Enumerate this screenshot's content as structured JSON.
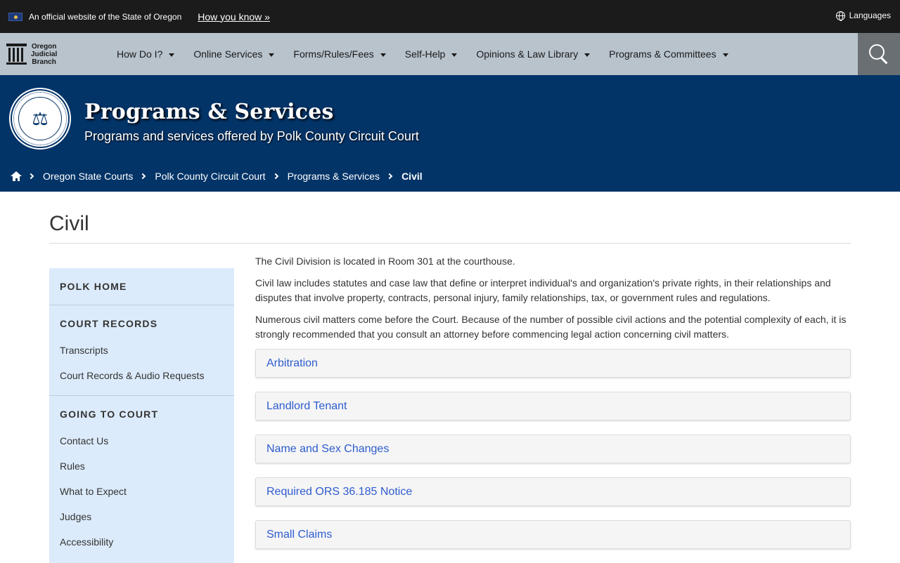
{
  "official": {
    "text": "An official website of the State of Oregon",
    "how_you_know": "How you know »",
    "languages": "Languages"
  },
  "logo": {
    "line1": "Oregon",
    "line2": "Judicial",
    "line3": "Branch"
  },
  "nav": {
    "items": [
      {
        "label": "How Do I?"
      },
      {
        "label": "Online Services"
      },
      {
        "label": "Forms/Rules/Fees"
      },
      {
        "label": "Self-Help"
      },
      {
        "label": "Opinions & Law Library"
      },
      {
        "label": "Programs & Committees"
      }
    ]
  },
  "banner": {
    "title": "Programs & Services",
    "subtitle": "Programs and services offered by Polk County Circuit Court"
  },
  "breadcrumb": {
    "items": [
      {
        "label": "Oregon State Courts"
      },
      {
        "label": "Polk County Circuit Court"
      },
      {
        "label": "Programs & Services"
      },
      {
        "label": "Civil"
      }
    ]
  },
  "page": {
    "title": "Civil",
    "paragraphs": [
      "The Civil Division is located in Room 301 at the courthouse.",
      "Civil law includes statutes and case law that define or interpret individual's and organization's private rights, in their relationships and disputes that involve property, contracts, personal injury, family relationships, tax, or government rules and regulations.",
      "Numerous civil matters come before the Court. Because of the number of possible civil actions and the potential complexity of each, it is strongly recommended that you consult an attorney before commencing legal action concerning civil matters."
    ],
    "accordions": [
      {
        "label": "Arbitration"
      },
      {
        "label": "Landlord Tenant"
      },
      {
        "label": "Name and Sex Changes"
      },
      {
        "label": "Required ORS 36.185 Notice"
      },
      {
        "label": "Small Claims"
      }
    ]
  },
  "sidebar": {
    "sections": [
      {
        "heading": "POLK HOME",
        "links": []
      },
      {
        "heading": "COURT RECORDS",
        "links": [
          {
            "label": "Transcripts"
          },
          {
            "label": "Court Records & Audio Requests"
          }
        ]
      },
      {
        "heading": "GOING TO COURT",
        "links": [
          {
            "label": "Contact Us"
          },
          {
            "label": "Rules"
          },
          {
            "label": "What to Expect"
          },
          {
            "label": "Judges"
          },
          {
            "label": "Accessibility"
          }
        ]
      }
    ]
  },
  "colors": {
    "banner": "#033468",
    "nav": "#b8c3cc",
    "official_bar": "#1b1b1b",
    "link": "#2e5ccf",
    "sidebar": "#dcebfb"
  }
}
